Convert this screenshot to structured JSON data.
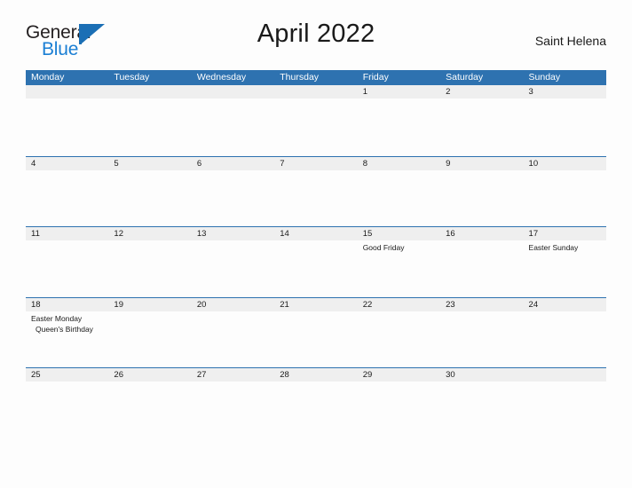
{
  "brand": {
    "name_part1": "General",
    "name_part2": "Blue",
    "flag_icon": "flag-triangle-icon",
    "color_dark": "#231f20",
    "color_blue": "#1b7fd4"
  },
  "header": {
    "title": "April 2022",
    "location": "Saint Helena"
  },
  "colors": {
    "header_blue": "#2e72b0",
    "date_band_gray": "#efefef",
    "cell_background": "#fdfdfd",
    "text": "#1a1a1a"
  },
  "calendar": {
    "month": "April",
    "year": "2022",
    "weekday_headers": [
      "Monday",
      "Tuesday",
      "Wednesday",
      "Thursday",
      "Friday",
      "Saturday",
      "Sunday"
    ],
    "weeks": [
      {
        "days": [
          {
            "date": "",
            "events": []
          },
          {
            "date": "",
            "events": []
          },
          {
            "date": "",
            "events": []
          },
          {
            "date": "",
            "events": []
          },
          {
            "date": "1",
            "events": []
          },
          {
            "date": "2",
            "events": []
          },
          {
            "date": "3",
            "events": []
          }
        ]
      },
      {
        "days": [
          {
            "date": "4",
            "events": []
          },
          {
            "date": "5",
            "events": []
          },
          {
            "date": "6",
            "events": []
          },
          {
            "date": "7",
            "events": []
          },
          {
            "date": "8",
            "events": []
          },
          {
            "date": "9",
            "events": []
          },
          {
            "date": "10",
            "events": []
          }
        ]
      },
      {
        "days": [
          {
            "date": "11",
            "events": []
          },
          {
            "date": "12",
            "events": []
          },
          {
            "date": "13",
            "events": []
          },
          {
            "date": "14",
            "events": []
          },
          {
            "date": "15",
            "events": [
              "Good Friday"
            ]
          },
          {
            "date": "16",
            "events": []
          },
          {
            "date": "17",
            "events": [
              "Easter Sunday"
            ]
          }
        ]
      },
      {
        "days": [
          {
            "date": "18",
            "events": [
              "Easter Monday",
              "Queen's Birthday"
            ]
          },
          {
            "date": "19",
            "events": []
          },
          {
            "date": "20",
            "events": []
          },
          {
            "date": "21",
            "events": []
          },
          {
            "date": "22",
            "events": []
          },
          {
            "date": "23",
            "events": []
          },
          {
            "date": "24",
            "events": []
          }
        ]
      },
      {
        "days": [
          {
            "date": "25",
            "events": []
          },
          {
            "date": "26",
            "events": []
          },
          {
            "date": "27",
            "events": []
          },
          {
            "date": "28",
            "events": []
          },
          {
            "date": "29",
            "events": []
          },
          {
            "date": "30",
            "events": []
          },
          {
            "date": "",
            "events": []
          }
        ]
      }
    ]
  }
}
